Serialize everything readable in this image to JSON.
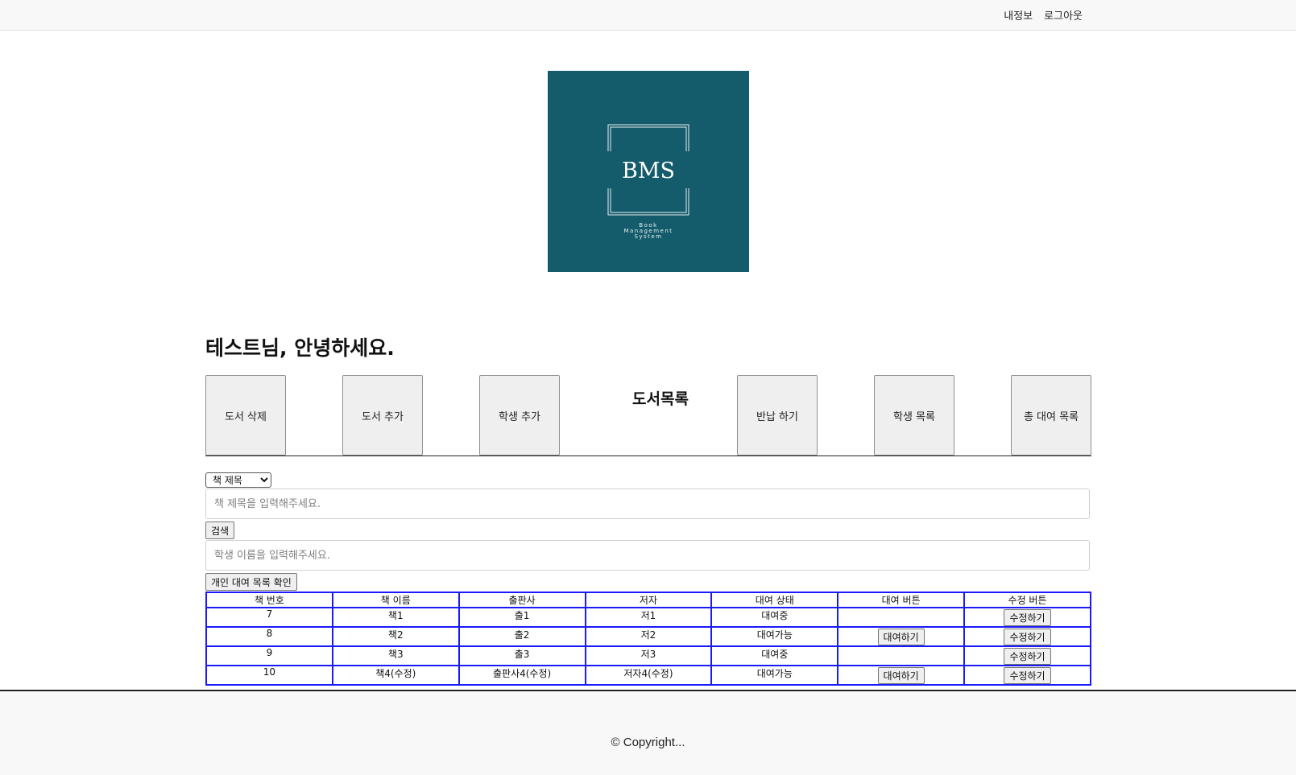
{
  "topbar": {
    "links": [
      "내정보",
      "로그아웃"
    ]
  },
  "logo": {
    "title": "BMS",
    "subtitle_lines": [
      "Book",
      "Management",
      "System"
    ],
    "bg_color": "#145c6b"
  },
  "greeting": "테스트님, 안녕하세요.",
  "nav": {
    "title": "도서목록",
    "buttons_left": [
      "도서 삭제",
      "도서 추가",
      "학생 추가"
    ],
    "buttons_right": [
      "반납 하기",
      "학생 목록",
      "총 대여 목록"
    ]
  },
  "search": {
    "select_value": "책 제목",
    "title_placeholder": "책 제목을 입력해주세요.",
    "search_button": "검색",
    "student_placeholder": "학생 이름을 입력해주세요.",
    "personal_button": "개인 대여 목록 확인"
  },
  "table": {
    "headers": [
      "책 번호",
      "책 이름",
      "출판사",
      "저자",
      "대여 상태",
      "대여 버튼",
      "수정 버튼"
    ],
    "rows": [
      {
        "id": "7",
        "name": "책1",
        "publisher": "출1",
        "author": "저1",
        "status": "대여중",
        "rent_label": "",
        "edit_label": "수정하기"
      },
      {
        "id": "8",
        "name": "책2",
        "publisher": "출2",
        "author": "저2",
        "status": "대여가능",
        "rent_label": "대여하기",
        "edit_label": "수정하기"
      },
      {
        "id": "9",
        "name": "책3",
        "publisher": "출3",
        "author": "저3",
        "status": "대여중",
        "rent_label": "",
        "edit_label": "수정하기"
      },
      {
        "id": "10",
        "name": "책4(수정)",
        "publisher": "출판사4(수정)",
        "author": "저자4(수정)",
        "status": "대여가능",
        "rent_label": "대여하기",
        "edit_label": "수정하기"
      }
    ]
  },
  "footer": {
    "copyright": "© Copyright..."
  },
  "colors": {
    "table_border": "#1a1aff",
    "logo_bg": "#145c6b"
  }
}
